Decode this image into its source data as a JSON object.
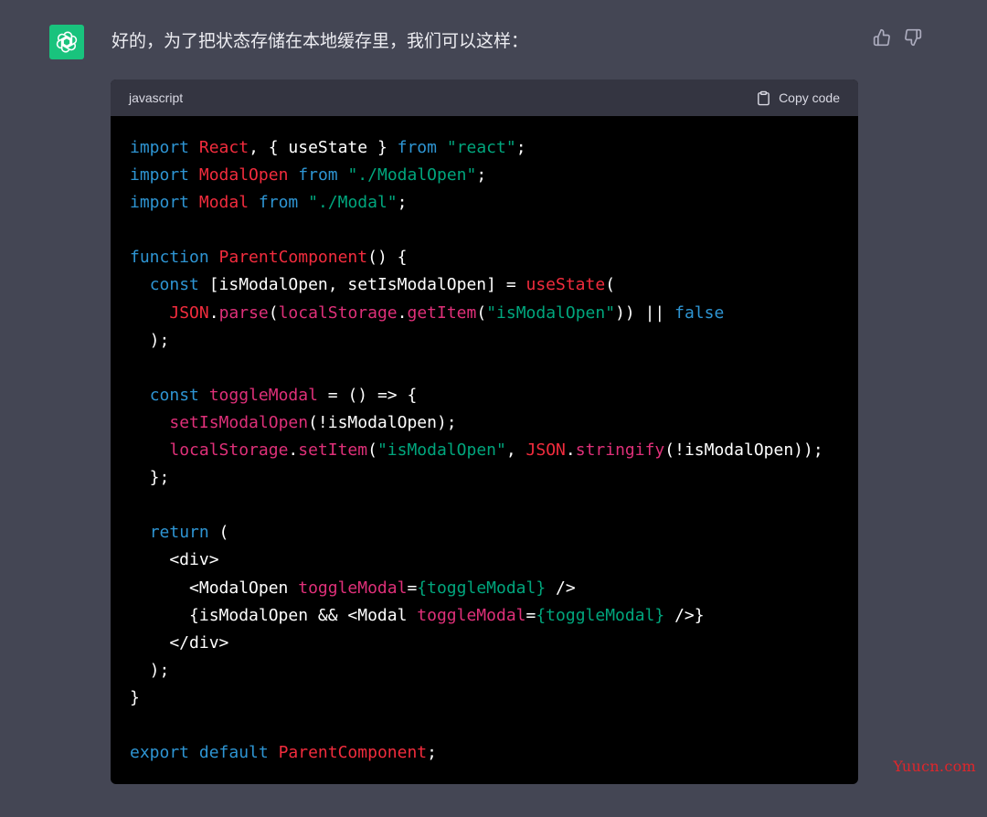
{
  "message": {
    "text": "好的，为了把状态存储在本地缓存里，我们可以这样："
  },
  "icons": {
    "avatar": "openai-logo-icon",
    "like": "thumbs-up-icon",
    "dislike": "thumbs-down-icon",
    "copy": "clipboard-icon"
  },
  "colors": {
    "background": "#444654",
    "avatar": "#19c37d",
    "code_background": "#000000",
    "code_header": "#343541",
    "keyword": "#2e95d3",
    "identifier": "#df3079",
    "string": "#00a67d",
    "watermark": "#e0262b"
  },
  "code": {
    "language": "javascript",
    "copy_label": "Copy code",
    "lines": [
      [
        {
          "t": "import",
          "c": "kw"
        },
        {
          "t": " ",
          "c": "pl"
        },
        {
          "t": "React",
          "c": "rd"
        },
        {
          "t": ", { useState } ",
          "c": "pl"
        },
        {
          "t": "from",
          "c": "kw"
        },
        {
          "t": " ",
          "c": "pl"
        },
        {
          "t": "\"react\"",
          "c": "str"
        },
        {
          "t": ";",
          "c": "pl"
        }
      ],
      [
        {
          "t": "import",
          "c": "kw"
        },
        {
          "t": " ",
          "c": "pl"
        },
        {
          "t": "ModalOpen",
          "c": "rd"
        },
        {
          "t": " ",
          "c": "pl"
        },
        {
          "t": "from",
          "c": "kw"
        },
        {
          "t": " ",
          "c": "pl"
        },
        {
          "t": "\"./ModalOpen\"",
          "c": "str"
        },
        {
          "t": ";",
          "c": "pl"
        }
      ],
      [
        {
          "t": "import",
          "c": "kw"
        },
        {
          "t": " ",
          "c": "pl"
        },
        {
          "t": "Modal",
          "c": "rd"
        },
        {
          "t": " ",
          "c": "pl"
        },
        {
          "t": "from",
          "c": "kw"
        },
        {
          "t": " ",
          "c": "pl"
        },
        {
          "t": "\"./Modal\"",
          "c": "str"
        },
        {
          "t": ";",
          "c": "pl"
        }
      ],
      [],
      [
        {
          "t": "function",
          "c": "kw"
        },
        {
          "t": " ",
          "c": "pl"
        },
        {
          "t": "ParentComponent",
          "c": "rd"
        },
        {
          "t": "() {",
          "c": "pl"
        }
      ],
      [
        {
          "t": "  ",
          "c": "pl"
        },
        {
          "t": "const",
          "c": "kw"
        },
        {
          "t": " [isModalOpen, setIsModalOpen] = ",
          "c": "pl"
        },
        {
          "t": "useState",
          "c": "rd"
        },
        {
          "t": "(",
          "c": "pl"
        }
      ],
      [
        {
          "t": "    ",
          "c": "pl"
        },
        {
          "t": "JSON",
          "c": "rd"
        },
        {
          "t": ".",
          "c": "pl"
        },
        {
          "t": "parse",
          "c": "id"
        },
        {
          "t": "(",
          "c": "pl"
        },
        {
          "t": "localStorage",
          "c": "id"
        },
        {
          "t": ".",
          "c": "pl"
        },
        {
          "t": "getItem",
          "c": "id"
        },
        {
          "t": "(",
          "c": "pl"
        },
        {
          "t": "\"isModalOpen\"",
          "c": "str"
        },
        {
          "t": ")) || ",
          "c": "pl"
        },
        {
          "t": "false",
          "c": "kw"
        }
      ],
      [
        {
          "t": "  );",
          "c": "pl"
        }
      ],
      [],
      [
        {
          "t": "  ",
          "c": "pl"
        },
        {
          "t": "const",
          "c": "kw"
        },
        {
          "t": " ",
          "c": "pl"
        },
        {
          "t": "toggleModal",
          "c": "id"
        },
        {
          "t": " = () => {",
          "c": "pl"
        }
      ],
      [
        {
          "t": "    ",
          "c": "pl"
        },
        {
          "t": "setIsModalOpen",
          "c": "id"
        },
        {
          "t": "(!isModalOpen);",
          "c": "pl"
        }
      ],
      [
        {
          "t": "    ",
          "c": "pl"
        },
        {
          "t": "localStorage",
          "c": "id"
        },
        {
          "t": ".",
          "c": "pl"
        },
        {
          "t": "setItem",
          "c": "id"
        },
        {
          "t": "(",
          "c": "pl"
        },
        {
          "t": "\"isModalOpen\"",
          "c": "str"
        },
        {
          "t": ", ",
          "c": "pl"
        },
        {
          "t": "JSON",
          "c": "rd"
        },
        {
          "t": ".",
          "c": "pl"
        },
        {
          "t": "stringify",
          "c": "id"
        },
        {
          "t": "(!isModalOpen));",
          "c": "pl"
        }
      ],
      [
        {
          "t": "  };",
          "c": "pl"
        }
      ],
      [],
      [
        {
          "t": "  ",
          "c": "pl"
        },
        {
          "t": "return",
          "c": "kw"
        },
        {
          "t": " (",
          "c": "pl"
        }
      ],
      [
        {
          "t": "    <div>",
          "c": "pl"
        }
      ],
      [
        {
          "t": "      <ModalOpen ",
          "c": "pl"
        },
        {
          "t": "toggleModal",
          "c": "id"
        },
        {
          "t": "=",
          "c": "pl"
        },
        {
          "t": "{toggleModal}",
          "c": "str"
        },
        {
          "t": " />",
          "c": "pl"
        }
      ],
      [
        {
          "t": "      {isModalOpen && <Modal ",
          "c": "pl"
        },
        {
          "t": "toggleModal",
          "c": "id"
        },
        {
          "t": "=",
          "c": "pl"
        },
        {
          "t": "{toggleModal}",
          "c": "str"
        },
        {
          "t": " />}",
          "c": "pl"
        }
      ],
      [
        {
          "t": "    </div>",
          "c": "pl"
        }
      ],
      [
        {
          "t": "  );",
          "c": "pl"
        }
      ],
      [
        {
          "t": "}",
          "c": "pl"
        }
      ],
      [],
      [
        {
          "t": "export",
          "c": "kw"
        },
        {
          "t": " ",
          "c": "pl"
        },
        {
          "t": "default",
          "c": "kw"
        },
        {
          "t": " ",
          "c": "pl"
        },
        {
          "t": "ParentComponent",
          "c": "rd"
        },
        {
          "t": ";",
          "c": "pl"
        }
      ]
    ]
  },
  "watermark": {
    "text": "Yuucn.com"
  }
}
